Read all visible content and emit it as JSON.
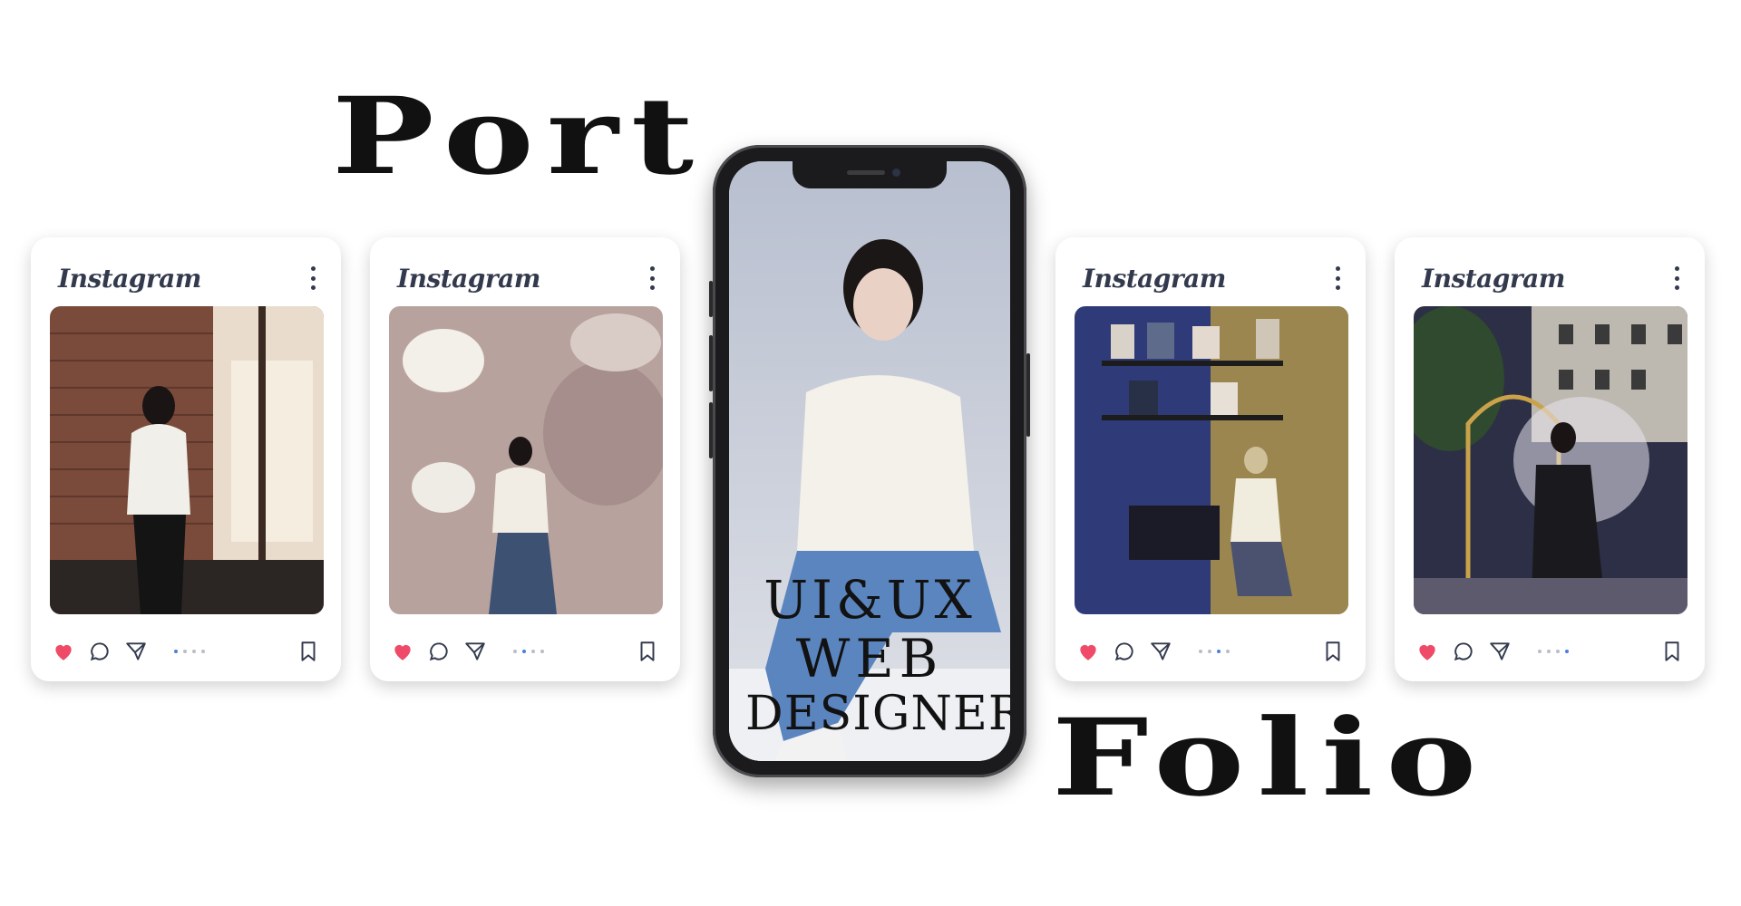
{
  "heading": {
    "top_word": "Port",
    "bottom_word": "Folio"
  },
  "phone": {
    "screen_lines": [
      "UI&UX",
      "WEB",
      "DESIGNER"
    ]
  },
  "cards": [
    {
      "app_name": "Instagram",
      "liked": true,
      "carousel_active_index": 0,
      "carousel_count": 4
    },
    {
      "app_name": "Instagram",
      "liked": true,
      "carousel_active_index": 1,
      "carousel_count": 4
    },
    {
      "app_name": "Instagram",
      "liked": true,
      "carousel_active_index": 2,
      "carousel_count": 4
    },
    {
      "app_name": "Instagram",
      "liked": true,
      "carousel_active_index": 3,
      "carousel_count": 4
    }
  ],
  "colors": {
    "like": "#ef4b68",
    "dot_active": "#4a7fd9",
    "icon": "#333a4d"
  }
}
